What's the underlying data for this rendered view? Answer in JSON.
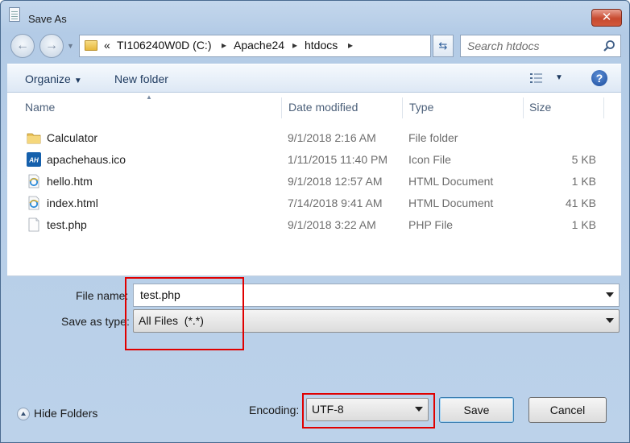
{
  "window": {
    "title": "Save As",
    "close_label": "✕"
  },
  "nav": {
    "back_label": "←",
    "forward_label": "→",
    "address": [
      "«",
      "TI106240W0D (C:)",
      "Apache24",
      "htdocs"
    ],
    "refresh_label": "⇆",
    "search_placeholder": "Search htdocs"
  },
  "toolbar": {
    "organize_label": "Organize",
    "new_folder_label": "New folder",
    "help_label": "?"
  },
  "columns": {
    "name": "Name",
    "date": "Date modified",
    "type": "Type",
    "size": "Size"
  },
  "files": [
    {
      "name": "Calculator",
      "date": "9/1/2018 2:16 AM",
      "type": "File folder",
      "size": "",
      "icon": "folder-icon"
    },
    {
      "name": "apachehaus.ico",
      "date": "1/11/2015 11:40 PM",
      "type": "Icon File",
      "size": "5 KB",
      "icon": "apachehaus-icon"
    },
    {
      "name": "hello.htm",
      "date": "9/1/2018 12:57 AM",
      "type": "HTML Document",
      "size": "1 KB",
      "icon": "ie-document-icon"
    },
    {
      "name": "index.html",
      "date": "7/14/2018 9:41 AM",
      "type": "HTML Document",
      "size": "41 KB",
      "icon": "ie-document-icon"
    },
    {
      "name": "test.php",
      "date": "9/1/2018 3:22 AM",
      "type": "PHP File",
      "size": "1 KB",
      "icon": "blank-document-icon"
    }
  ],
  "form": {
    "file_name_label": "File name:",
    "file_name_value": "test.php",
    "save_type_label": "Save as type:",
    "save_type_value": "All Files  (*.*)",
    "encoding_label": "Encoding:",
    "encoding_value": "UTF-8"
  },
  "footer": {
    "hide_folders_label": "Hide Folders",
    "save_label": "Save",
    "cancel_label": "Cancel"
  },
  "colors": {
    "highlight": "#e00000",
    "accent": "#1e3a5f"
  }
}
